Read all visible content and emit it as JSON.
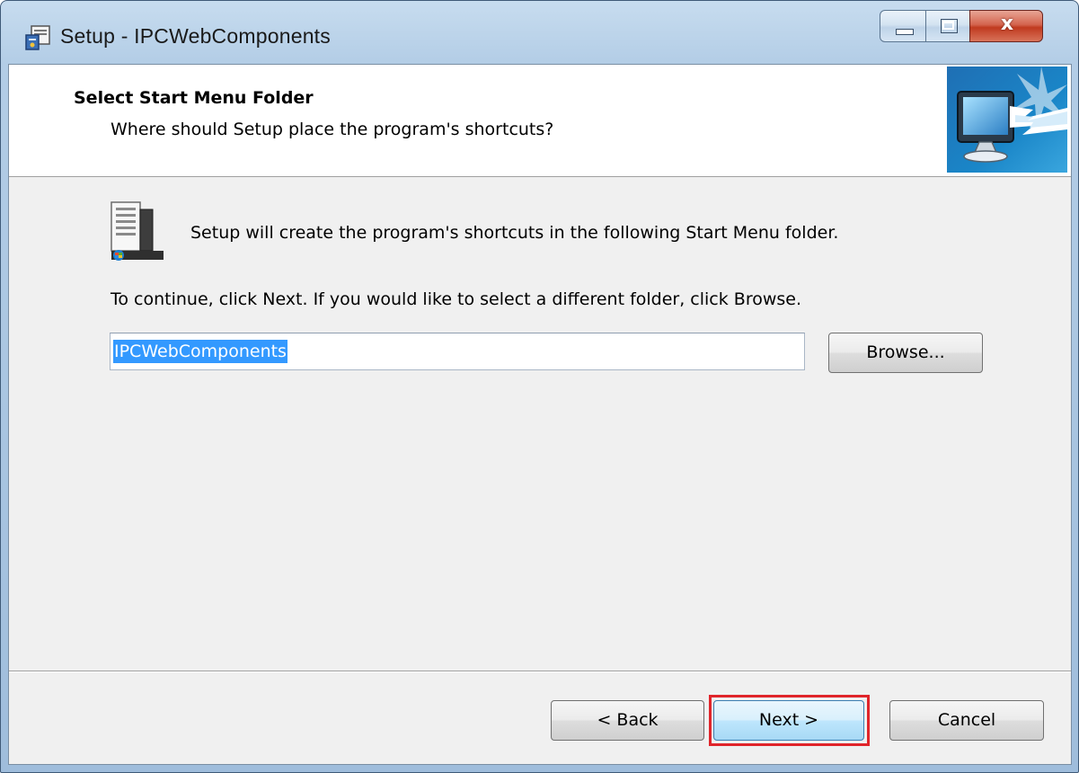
{
  "window": {
    "title": "Setup - IPCWebComponents"
  },
  "header": {
    "title": "Select Start Menu Folder",
    "subtitle": "Where should Setup place the program's shortcuts?"
  },
  "body": {
    "intro": "Setup will create the program's shortcuts in the following Start Menu folder.",
    "instruction": "To continue, click Next. If you would like to select a different folder, click Browse.",
    "folder_value": "IPCWebComponents",
    "browse_label": "Browse..."
  },
  "footer": {
    "back_label": "< Back",
    "next_label": "Next >",
    "cancel_label": "Cancel"
  },
  "colors": {
    "highlight": "#e0252b",
    "selection": "#3399ff"
  },
  "icons": {
    "app": "installer-icon",
    "header": "computer-monitor-icon",
    "folder": "start-menu-folder-icon"
  }
}
